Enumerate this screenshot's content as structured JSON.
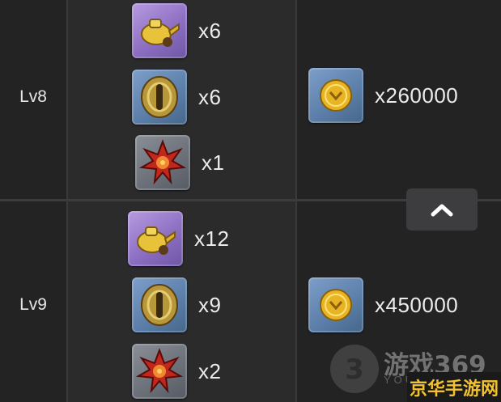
{
  "rows": [
    {
      "level": "Lv8",
      "materials": [
        {
          "icon": "gold-teapot-icon",
          "rarity": "purple",
          "qty": "x6"
        },
        {
          "icon": "bronze-tsuba-icon",
          "rarity": "blue",
          "qty": "x6"
        },
        {
          "icon": "crimson-bloom-icon",
          "rarity": "grey",
          "qty": "x1"
        }
      ],
      "coin": {
        "icon": "gold-coin-icon",
        "qty": "x260000"
      }
    },
    {
      "level": "Lv9",
      "materials": [
        {
          "icon": "gold-teapot-icon",
          "rarity": "purple",
          "qty": "x12"
        },
        {
          "icon": "bronze-tsuba-icon",
          "rarity": "blue",
          "qty": "x9"
        },
        {
          "icon": "crimson-bloom-icon",
          "rarity": "grey",
          "qty": "x2"
        }
      ],
      "coin": {
        "icon": "gold-coin-icon",
        "qty": "x450000"
      }
    }
  ],
  "scroll_button": {
    "icon": "chevron-up-icon"
  },
  "watermark": {
    "title": "游戏369",
    "subtitle": "YOU",
    "logo_glyph": "3"
  },
  "site_badge": "京华手游网",
  "colors": {
    "purple_frame": "#8a6cc0",
    "blue_frame": "#5a7ea8",
    "grey_frame": "#6a6f78",
    "gold": "#e8b423",
    "badge_text": "#f2c230"
  }
}
